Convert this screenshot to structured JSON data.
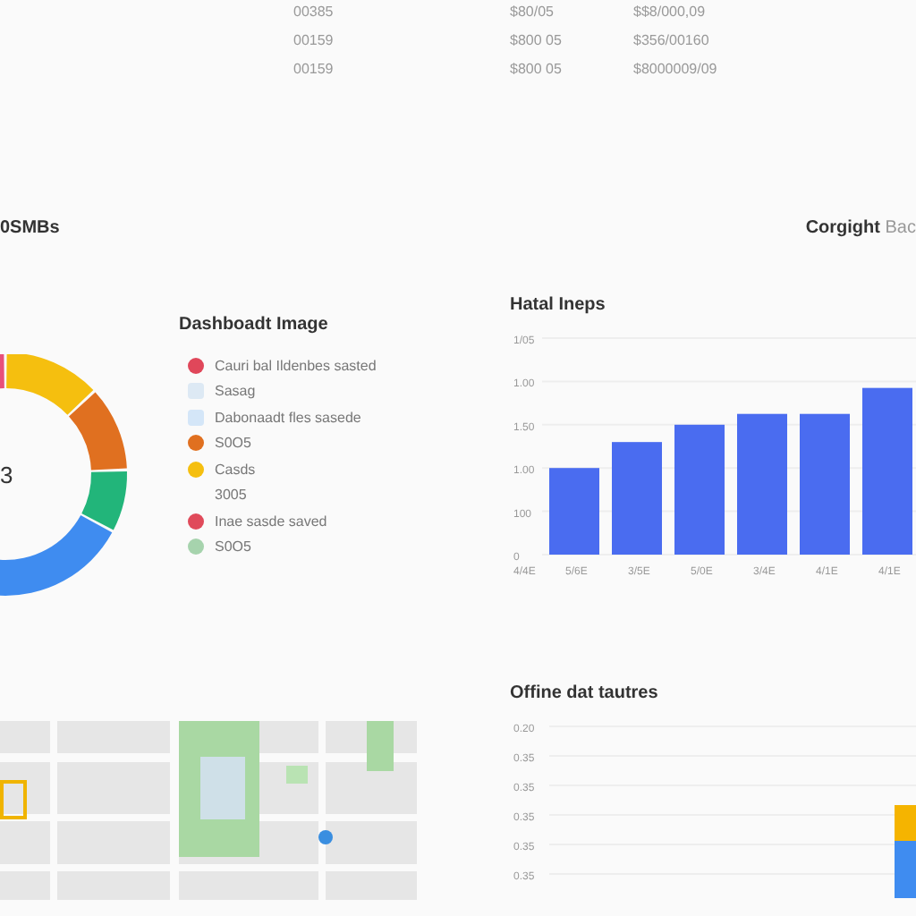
{
  "table": {
    "rows": [
      {
        "cells": [
          "00385",
          "$80/05",
          "$$8/000,09"
        ]
      },
      {
        "cells": [
          "00159",
          "$800 05",
          "$356/00160"
        ]
      },
      {
        "cells": [
          "00159",
          "$800 05",
          "$8000009/09"
        ]
      }
    ]
  },
  "section_label": "0SMBs",
  "header_right": {
    "title": "Corgight",
    "subtitle": "Bac"
  },
  "donut": {
    "center_label": "3"
  },
  "legend": {
    "title": "Dashboadt Image",
    "items": [
      {
        "label": "Cauri bal Ildenbes sasted",
        "color": "#e0475a"
      },
      {
        "label": "Sasag",
        "color": "#dde9f4"
      },
      {
        "label": "Dabonaadt fles sasede",
        "color": "#d4e6f8"
      },
      {
        "label": "S0O5",
        "color": "#e07020"
      },
      {
        "label": "Casds",
        "color": "#f5bf0f"
      },
      {
        "label": "3005"
      },
      {
        "label": "Inae sasde saved",
        "color": "#e04a5a"
      },
      {
        "label": "S0O5",
        "color": "#a6d3ad"
      }
    ]
  },
  "bar_chart": {
    "title": "Hatal Ineps",
    "y_tick_labels": [
      "1/05",
      "1.00",
      "1.50",
      "1.00",
      "100",
      "0"
    ],
    "x_labels": [
      "4/4E",
      "5/6E",
      "3/5E",
      "5/0E",
      "3/4E",
      "4/1E",
      "4/1E"
    ]
  },
  "lower_chart": {
    "title": "Offine dat tautres",
    "tick_labels": [
      "0.20",
      "0.35",
      "0.35",
      "0.35",
      "0.35",
      "0.35"
    ]
  }
}
